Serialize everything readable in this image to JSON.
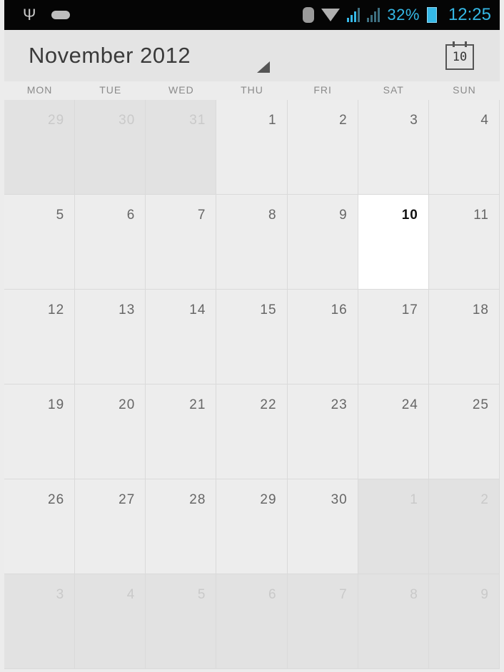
{
  "status_bar": {
    "battery_percent": "32%",
    "time": "12:25",
    "icons": [
      "usb-icon",
      "usb-debug-icon",
      "bluetooth-icon",
      "wifi-icon",
      "signal-icon",
      "signal-icon",
      "battery-icon"
    ],
    "accent_color": "#35b8e6"
  },
  "header": {
    "month_title": "November 2012",
    "today_button_day": "10"
  },
  "weekdays": [
    "MON",
    "TUE",
    "WED",
    "THU",
    "FRI",
    "SAT",
    "SUN"
  ],
  "weeks": [
    [
      "29",
      "30",
      "31",
      "1",
      "2",
      "3",
      "4"
    ],
    [
      "5",
      "6",
      "7",
      "8",
      "9",
      "10",
      "11"
    ],
    [
      "12",
      "13",
      "14",
      "15",
      "16",
      "17",
      "18"
    ],
    [
      "19",
      "20",
      "21",
      "22",
      "23",
      "24",
      "25"
    ],
    [
      "26",
      "27",
      "28",
      "29",
      "30",
      "1",
      "2"
    ],
    [
      "3",
      "4",
      "5",
      "6",
      "7",
      "8",
      "9"
    ]
  ],
  "today": "10"
}
